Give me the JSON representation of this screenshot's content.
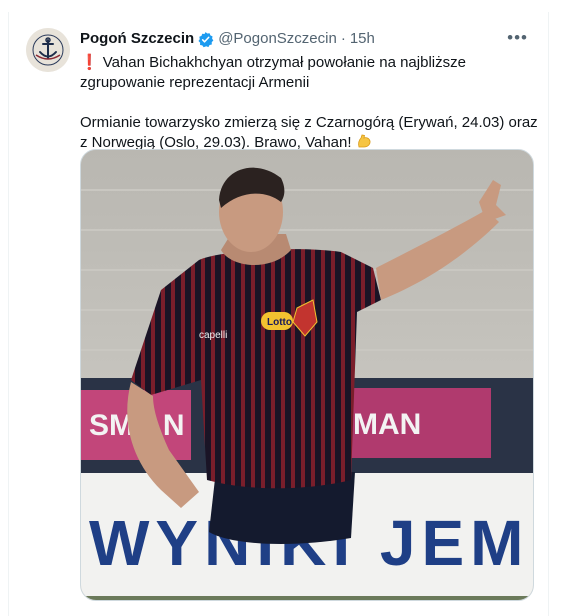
{
  "tweet": {
    "author_name": "Pogoń Szczecin",
    "handle": "@PogonSzczecin",
    "separator": "·",
    "time": "15h",
    "more_label": "•••",
    "line1": "Vahan Bichakhchyan otrzymał powołanie na najbliższe zgrupowanie reprezentacji Armenii",
    "line2": "Ormianie towarzysko zmierzą się z Czarnogórą (Erywań, 24.03) oraz z Norwegią (Oslo, 29.03). Brawo, Vahan!",
    "banner_text": "WYNIKI JEM",
    "shirt_sponsor": "Lotto",
    "shirt_brand": "capelli",
    "ad_left": "SM AN",
    "ad_right": "MAN",
    "colors": {
      "verified": "#1d9bf0",
      "text_secondary": "#536471",
      "border": "#cfd9de",
      "banner_blue": "#1f3f86",
      "kit_dark": "#1a1426",
      "kit_stripe": "#7a1e2b"
    }
  }
}
